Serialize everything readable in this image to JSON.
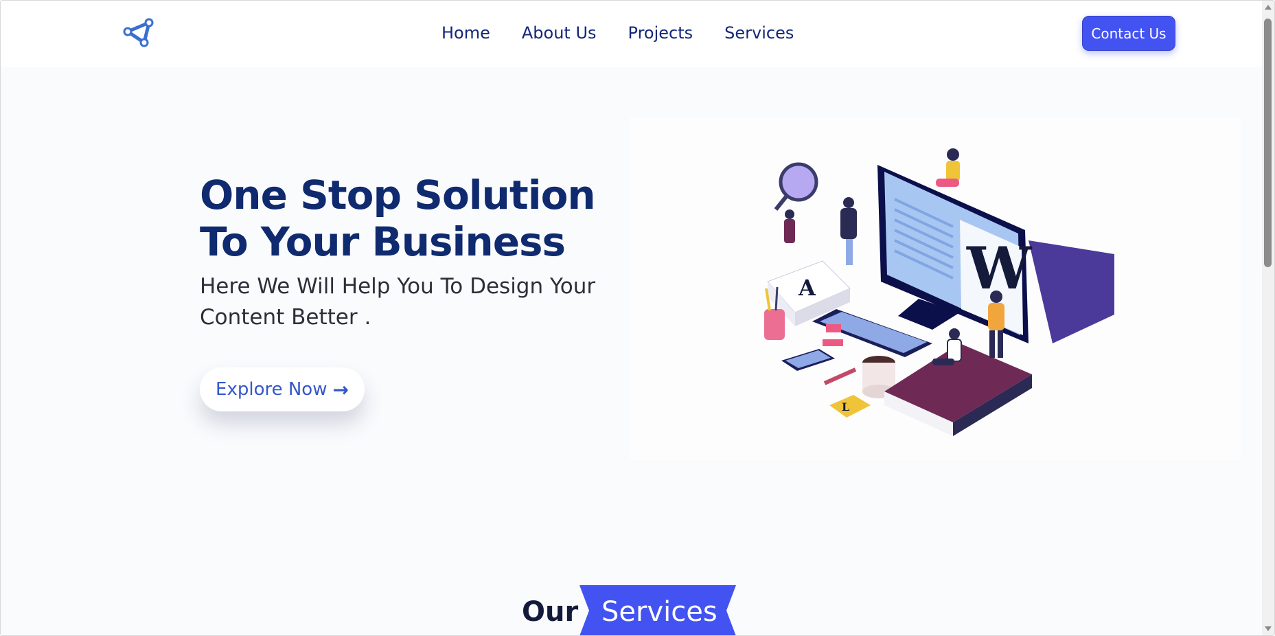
{
  "header": {
    "logo_icon": "share-triangle-icon",
    "nav": [
      {
        "label": "Home"
      },
      {
        "label": "About Us"
      },
      {
        "label": "Projects"
      },
      {
        "label": "Services"
      }
    ],
    "contact_label": "Contact Us"
  },
  "hero": {
    "title": "One Stop Solution To Your Business",
    "subtitle": "Here We Will Help You To Design Your Content Better .",
    "cta_label": "Explore Now",
    "cta_icon": "arrow-right-icon",
    "illustration": "isometric-workspace-illustration"
  },
  "services": {
    "heading_prefix": "Our",
    "heading_highlight": "Services"
  },
  "colors": {
    "primary": "#4353f2",
    "navy": "#0f2a6e",
    "nav_text": "#13267a",
    "page_bg": "#fafbfd"
  }
}
